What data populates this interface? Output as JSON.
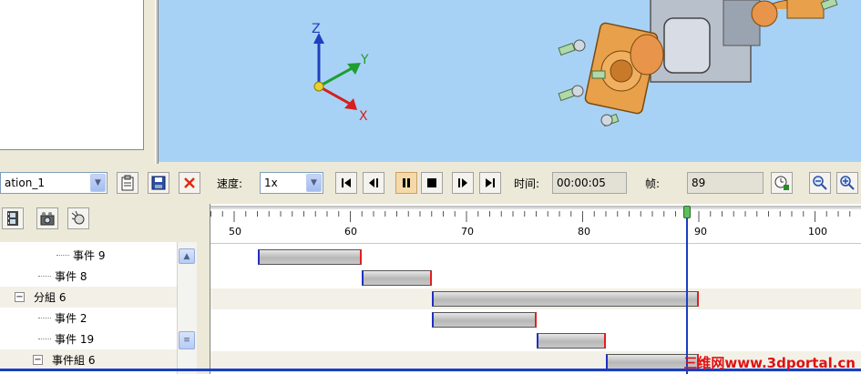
{
  "toolbar": {
    "animation_name": "ation_1",
    "speed_label": "速度:",
    "speed_value": "1x",
    "time_label": "时间:",
    "time_value": "00:00:05",
    "frame_label": "帧:",
    "frame_value": "89"
  },
  "axes": {
    "z": "Z",
    "y": "Y",
    "x": "X"
  },
  "tree": {
    "rows": [
      {
        "label": "事件 9"
      },
      {
        "label": "事件 8"
      },
      {
        "label": "分組 6"
      },
      {
        "label": "事件 2"
      },
      {
        "label": "事件 19"
      },
      {
        "label": "事件組 6"
      }
    ]
  },
  "timeline": {
    "ruler_ticks": [
      "50",
      "60",
      "70",
      "80",
      "90",
      "100"
    ],
    "current_frame": 89,
    "events": [
      {
        "start": 52,
        "end": 61
      },
      {
        "start": 61,
        "end": 67
      },
      {
        "start": 67,
        "end": 90
      },
      {
        "start": 67,
        "end": 76
      },
      {
        "start": 76,
        "end": 82
      },
      {
        "start": 82,
        "end": 90
      }
    ]
  },
  "watermark": "三维网www.3dportal.cn",
  "colors": {
    "viewport_bg": "#a8d2f5",
    "accent": "#1a3fbf",
    "bar_start": "#2030c0",
    "bar_end": "#e02020"
  }
}
